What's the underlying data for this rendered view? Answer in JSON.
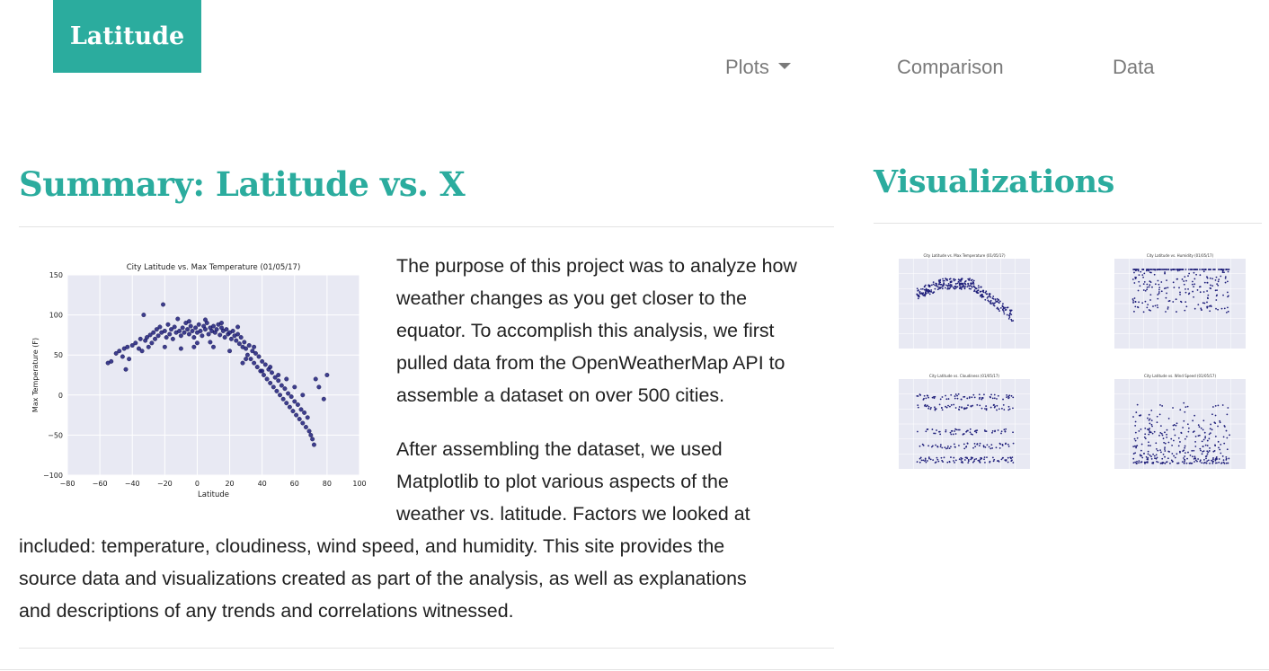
{
  "nav": {
    "brand": "Latitude",
    "items": [
      {
        "label": "Plots",
        "has_dropdown": true
      },
      {
        "label": "Comparison"
      },
      {
        "label": "Data"
      }
    ]
  },
  "summary": {
    "title": "Summary: Latitude vs. X",
    "paragraph1_lines": [
      "The purpose of this project was to analyze how",
      "weather changes as you get closer to the",
      "equator. To accomplish this analysis, we first",
      "pulled data from the OpenWeatherMap API to",
      "assemble a dataset on over 500 cities."
    ],
    "paragraph2_lines": [
      "After assembling the dataset, we used",
      "Matplotlib to plot various aspects of the",
      "weather vs. latitude. Factors we looked at",
      "included: temperature, cloudiness, wind speed, and humidity. This site provides the",
      "source data and visualizations created as part of the analysis, as well as explanations",
      "and descriptions of any trends and correlations witnessed."
    ]
  },
  "visualizations": {
    "title": "Visualizations"
  },
  "colors": {
    "accent": "#2bac9e",
    "nav_text": "#7a7a7a",
    "plot_bg": "#e8e9f3",
    "point": "#1f1f7a"
  },
  "chart_data": [
    {
      "type": "scatter",
      "title": "City Latitude vs. Max Temperature (01/05/17)",
      "xlabel": "Latitude",
      "ylabel": "Max Temperature (F)",
      "xlim": [
        -80,
        100
      ],
      "ylim": [
        -100,
        150
      ],
      "xticks": [
        -80,
        -60,
        -40,
        -20,
        0,
        20,
        40,
        60,
        80,
        100
      ],
      "yticks": [
        -100,
        -50,
        0,
        50,
        100,
        150
      ],
      "grid": true,
      "points": [
        [
          -55,
          40
        ],
        [
          -53,
          42
        ],
        [
          -50,
          52
        ],
        [
          -48,
          55
        ],
        [
          -46,
          48
        ],
        [
          -45,
          58
        ],
        [
          -43,
          60
        ],
        [
          -42,
          45
        ],
        [
          -40,
          62
        ],
        [
          -38,
          65
        ],
        [
          -36,
          58
        ],
        [
          -35,
          70
        ],
        [
          -34,
          55
        ],
        [
          -33,
          100
        ],
        [
          -32,
          68
        ],
        [
          -31,
          72
        ],
        [
          -30,
          60
        ],
        [
          -29,
          75
        ],
        [
          -28,
          65
        ],
        [
          -27,
          78
        ],
        [
          -26,
          70
        ],
        [
          -25,
          82
        ],
        [
          -24,
          74
        ],
        [
          -23,
          85
        ],
        [
          -22,
          78
        ],
        [
          -21,
          113
        ],
        [
          -20,
          80
        ],
        [
          -19,
          72
        ],
        [
          -18,
          88
        ],
        [
          -17,
          76
        ],
        [
          -16,
          82
        ],
        [
          -15,
          70
        ],
        [
          -14,
          85
        ],
        [
          -13,
          78
        ],
        [
          -12,
          95
        ],
        [
          -11,
          80
        ],
        [
          -10,
          74
        ],
        [
          -9,
          84
        ],
        [
          -8,
          78
        ],
        [
          -7,
          90
        ],
        [
          -6,
          82
        ],
        [
          -5,
          76
        ],
        [
          -4,
          86
        ],
        [
          -3,
          80
        ],
        [
          -2,
          72
        ],
        [
          -1,
          84
        ],
        [
          0,
          78
        ],
        [
          1,
          88
        ],
        [
          2,
          80
        ],
        [
          3,
          74
        ],
        [
          4,
          86
        ],
        [
          5,
          82
        ],
        [
          6,
          90
        ],
        [
          7,
          76
        ],
        [
          8,
          84
        ],
        [
          9,
          80
        ],
        [
          10,
          86
        ],
        [
          11,
          78
        ],
        [
          12,
          82
        ],
        [
          13,
          88
        ],
        [
          14,
          75
        ],
        [
          15,
          84
        ],
        [
          16,
          80
        ],
        [
          17,
          72
        ],
        [
          18,
          82
        ],
        [
          19,
          76
        ],
        [
          20,
          78
        ],
        [
          21,
          70
        ],
        [
          22,
          80
        ],
        [
          23,
          74
        ],
        [
          24,
          68
        ],
        [
          25,
          76
        ],
        [
          26,
          64
        ],
        [
          27,
          72
        ],
        [
          28,
          60
        ],
        [
          29,
          66
        ],
        [
          30,
          58
        ],
        [
          31,
          50
        ],
        [
          32,
          62
        ],
        [
          33,
          45
        ],
        [
          34,
          55
        ],
        [
          35,
          40
        ],
        [
          36,
          52
        ],
        [
          37,
          35
        ],
        [
          38,
          48
        ],
        [
          39,
          30
        ],
        [
          40,
          42
        ],
        [
          41,
          25
        ],
        [
          42,
          38
        ],
        [
          43,
          20
        ],
        [
          44,
          32
        ],
        [
          45,
          15
        ],
        [
          46,
          28
        ],
        [
          47,
          10
        ],
        [
          48,
          22
        ],
        [
          49,
          5
        ],
        [
          50,
          18
        ],
        [
          51,
          0
        ],
        [
          52,
          12
        ],
        [
          53,
          -5
        ],
        [
          54,
          8
        ],
        [
          55,
          -10
        ],
        [
          56,
          2
        ],
        [
          57,
          -15
        ],
        [
          58,
          -2
        ],
        [
          59,
          -20
        ],
        [
          60,
          -8
        ],
        [
          61,
          -25
        ],
        [
          62,
          -12
        ],
        [
          63,
          -30
        ],
        [
          64,
          -18
        ],
        [
          65,
          -35
        ],
        [
          66,
          -22
        ],
        [
          67,
          -40
        ],
        [
          68,
          -28
        ],
        [
          69,
          -45
        ],
        [
          70,
          -50
        ],
        [
          71,
          -55
        ],
        [
          72,
          -62
        ],
        [
          73,
          20
        ],
        [
          75,
          10
        ],
        [
          78,
          -5
        ],
        [
          80,
          25
        ],
        [
          -20,
          60
        ],
        [
          -10,
          58
        ],
        [
          0,
          65
        ],
        [
          10,
          60
        ],
        [
          20,
          55
        ],
        [
          30,
          45
        ],
        [
          40,
          30
        ],
        [
          50,
          25
        ],
        [
          60,
          10
        ],
        [
          -5,
          92
        ],
        [
          5,
          94
        ],
        [
          15,
          90
        ],
        [
          25,
          85
        ],
        [
          35,
          60
        ],
        [
          45,
          35
        ],
        [
          55,
          20
        ],
        [
          65,
          0
        ],
        [
          -44,
          32
        ],
        [
          -2,
          60
        ],
        [
          8,
          66
        ],
        [
          28,
          40
        ]
      ]
    }
  ],
  "thumbnails": [
    {
      "title": "City Latitude vs. Max Temperature (01/05/17)",
      "kind": "temp"
    },
    {
      "title": "City Latitude vs. Humidity (01/05/17)",
      "kind": "humidity"
    },
    {
      "title": "City Latitude vs. Cloudiness (01/05/17)",
      "kind": "cloud"
    },
    {
      "title": "City Latitude vs. Wind Speed (01/05/17)",
      "kind": "wind"
    }
  ]
}
